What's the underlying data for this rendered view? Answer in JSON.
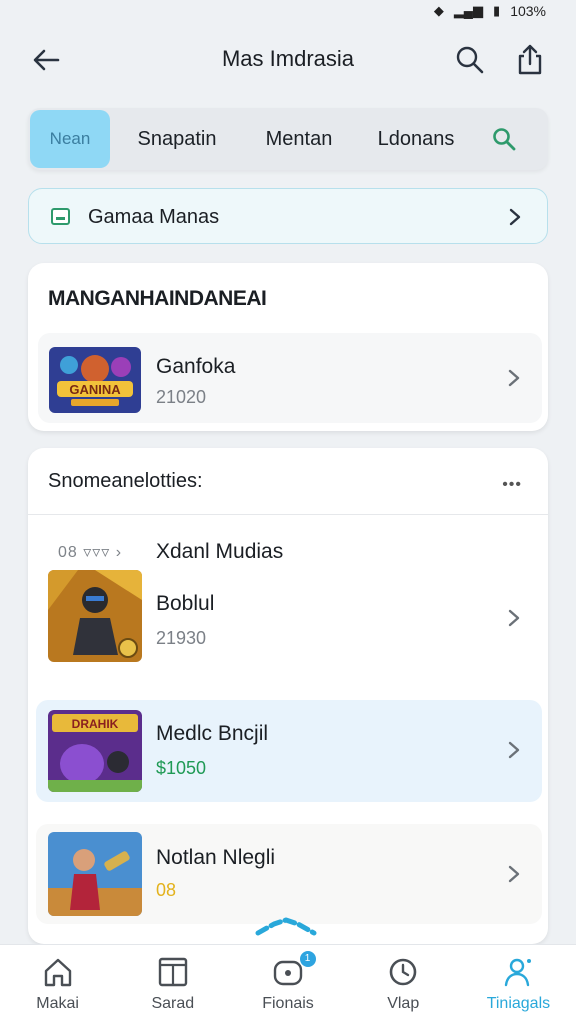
{
  "status_bar": {
    "battery_text": "103%"
  },
  "app_bar": {
    "title": "Mas Imdrasia"
  },
  "tabs": [
    {
      "label": "Nean",
      "active": true
    },
    {
      "label": "Snapatin",
      "active": false
    },
    {
      "label": "Mentan",
      "active": false
    },
    {
      "label": "Ldonans",
      "active": false
    }
  ],
  "banner": {
    "label": "Gamaa Manas"
  },
  "featured": {
    "heading": "MANGANHAINDANEAI",
    "item": {
      "title": "Ganfoka",
      "subtitle": "21020"
    }
  },
  "section": {
    "heading": "Snomeanelotties:",
    "more": "•••",
    "items": [
      {
        "meta": "08 ▿▿▿ ›",
        "category": "Xdanl Mudias",
        "title": "Boblul",
        "subtitle": "21930"
      },
      {
        "title": "Medlc Bncjil",
        "subtitle": "$1050",
        "subtitle_color": "#1f9a55"
      },
      {
        "title": "Notlan Nlegli",
        "subtitle": "08",
        "subtitle_color": "#e3b21c"
      }
    ]
  },
  "bottom_nav": [
    {
      "label": "Makai",
      "icon": "home-icon",
      "active": false
    },
    {
      "label": "Sarad",
      "icon": "book-icon",
      "active": false
    },
    {
      "label": "Fionais",
      "icon": "gamepad-icon",
      "active": false,
      "badge": "1"
    },
    {
      "label": "Vlap",
      "icon": "clock-icon",
      "active": false
    },
    {
      "label": "Tiniagals",
      "icon": "person-icon",
      "active": true
    }
  ],
  "colors": {
    "accent": "#29a8da",
    "active_tab": "#8fd8f5",
    "green": "#2e9a6c"
  }
}
